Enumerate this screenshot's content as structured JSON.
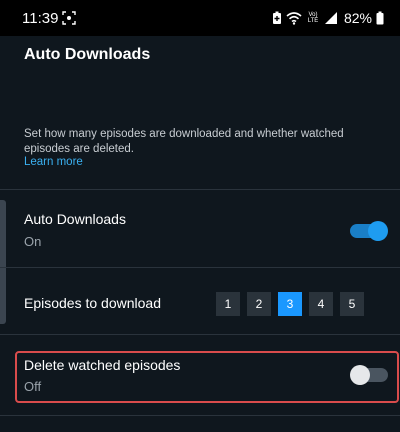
{
  "status_bar": {
    "time": "11:39",
    "network_label_top": "Vo)",
    "network_label_bottom": "LTE",
    "battery_percent": "82%"
  },
  "header": {
    "title": "Auto Downloads"
  },
  "description": {
    "text": "Set how many episodes are downloaded and whether watched episodes are deleted.",
    "learn_more": "Learn more"
  },
  "settings": {
    "auto_downloads": {
      "label": "Auto Downloads",
      "value": "On",
      "enabled": true
    },
    "episodes_to_download": {
      "label": "Episodes to download",
      "options": [
        "1",
        "2",
        "3",
        "4",
        "5"
      ],
      "selected": "3"
    },
    "delete_watched": {
      "label": "Delete watched episodes",
      "value": "Off",
      "enabled": false
    }
  },
  "colors": {
    "background": "#0f171e",
    "accent": "#1a98ff",
    "link": "#3ab0f0",
    "highlight": "#d94c4c"
  }
}
